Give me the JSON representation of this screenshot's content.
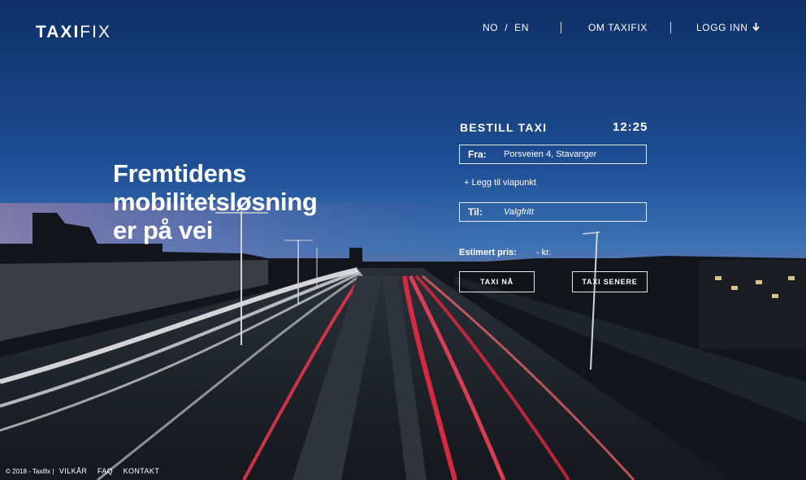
{
  "brand": {
    "part1": "TAXI",
    "part2": "FIX"
  },
  "nav": {
    "lang_no": "NO",
    "lang_sep": "/",
    "lang_en": "EN",
    "about": "OM TAXIFIX",
    "login": "LOGG INN",
    "login_icon": "arrow-down-icon"
  },
  "hero": {
    "line1": "Fremtidens",
    "line2": "mobilitetsløsning",
    "line3": "er på vei"
  },
  "booking": {
    "title": "BESTILL TAXI",
    "time": "12:25",
    "from_label": "Fra:",
    "from_value": "Porsveien 4, Stavanger",
    "add_via": "+ Legg til viapunkt",
    "to_label": "Til:",
    "to_value": "Valgfritt",
    "price_label": "Estimert pris:",
    "price_value": "- kr.",
    "btn_now": "TAXI NÅ",
    "btn_later": "TAXI SENERE"
  },
  "footer": {
    "copyright": "© 2018 - Taxifix |",
    "terms": "VILKÅR",
    "faq": "FAQ",
    "contact": "KONTAKT"
  },
  "colors": {
    "sky_top": "#143a78",
    "sky_mid": "#2a5ea8",
    "horizon": "#7d6a9a",
    "road": "#1c2128",
    "trail_red": "#e0304a",
    "trail_white": "#f2f2f5"
  }
}
